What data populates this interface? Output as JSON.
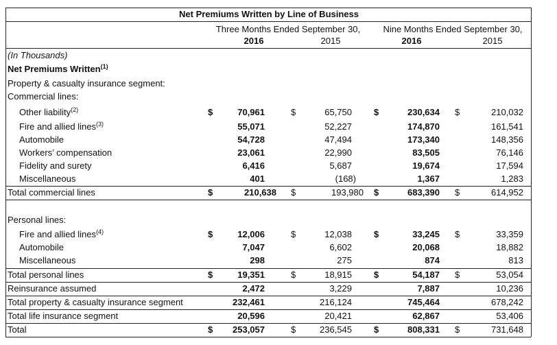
{
  "title": "Net Premiums Written by Line of Business",
  "col_group_1": "Three Months Ended September 30,",
  "col_group_2": "Nine Months Ended September 30,",
  "years": [
    "2016",
    "2015",
    "2016",
    "2015"
  ],
  "units_label": "(In Thousands)",
  "dollar": "$",
  "section_heading": "Net Premiums Written",
  "section_heading_note": "(1)",
  "segment_heading": "Property & casualty insurance segment:",
  "commercial_heading": "Commercial lines:",
  "personal_heading": "Personal lines:",
  "commercial_rows": [
    {
      "label": "Other liability",
      "note": "(2)",
      "q16": "70,961",
      "q15": "65,750",
      "n16": "230,634",
      "n15": "210,032"
    },
    {
      "label": "Fire and allied lines",
      "note": "(3)",
      "q16": "55,071",
      "q15": "52,227",
      "n16": "174,870",
      "n15": "161,541"
    },
    {
      "label": "Automobile",
      "note": "",
      "q16": "54,728",
      "q15": "47,494",
      "n16": "173,340",
      "n15": "148,356"
    },
    {
      "label": "Workers’ compensation",
      "note": "",
      "q16": "23,061",
      "q15": "22,990",
      "n16": "83,505",
      "n15": "76,146"
    },
    {
      "label": "Fidelity and surety",
      "note": "",
      "q16": "6,416",
      "q15": "5,687",
      "n16": "19,674",
      "n15": "17,594"
    },
    {
      "label": "Miscellaneous",
      "note": "",
      "q16": "401",
      "q15": "(168)",
      "n16": "1,367",
      "n15": "1,283"
    }
  ],
  "total_commercial": {
    "label": "Total commercial lines",
    "q16": "210,638",
    "q15": "193,980",
    "n16": "683,390",
    "n15": "614,952"
  },
  "personal_rows": [
    {
      "label": "Fire and allied lines",
      "note": "(4)",
      "q16": "12,006",
      "q15": "12,038",
      "n16": "33,245",
      "n15": "33,359"
    },
    {
      "label": "Automobile",
      "note": "",
      "q16": "7,047",
      "q15": "6,602",
      "n16": "20,068",
      "n15": "18,882"
    },
    {
      "label": "Miscellaneous",
      "note": "",
      "q16": "298",
      "q15": "275",
      "n16": "874",
      "n15": "813"
    }
  ],
  "total_personal": {
    "label": "Total personal lines",
    "q16": "19,351",
    "q15": "18,915",
    "n16": "54,187",
    "n15": "53,054"
  },
  "reinsurance": {
    "label": "Reinsurance assumed",
    "q16": "2,472",
    "q15": "3,229",
    "n16": "7,887",
    "n15": "10,236"
  },
  "total_pc": {
    "label": "Total property & casualty insurance segment",
    "q16": "232,461",
    "q15": "216,124",
    "n16": "745,464",
    "n15": "678,242"
  },
  "total_life": {
    "label": "Total life insurance segment",
    "q16": "20,596",
    "q15": "20,421",
    "n16": "62,867",
    "n15": "53,406"
  },
  "grand_total": {
    "label": "Total",
    "q16": "253,057",
    "q15": "236,545",
    "n16": "808,331",
    "n15": "731,648"
  }
}
